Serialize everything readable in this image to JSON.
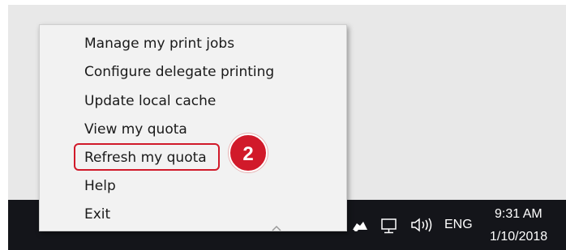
{
  "context_menu": {
    "items": [
      {
        "label": "Manage my print jobs"
      },
      {
        "label": "Configure delegate printing"
      },
      {
        "label": "Update local cache"
      },
      {
        "label": "View my quota"
      },
      {
        "label": "Refresh my quota",
        "highlighted": true
      },
      {
        "label": "Help"
      },
      {
        "label": "Exit"
      }
    ]
  },
  "callout": {
    "step_number": "2",
    "color": "#d11a2a"
  },
  "taskbar": {
    "background": "#14151a",
    "tray_icons": [
      "chevron-up-icon",
      "cloud-icon",
      "network-icon",
      "volume-icon"
    ],
    "language": "ENG",
    "time": "9:31 AM",
    "date": "1/10/2018"
  }
}
